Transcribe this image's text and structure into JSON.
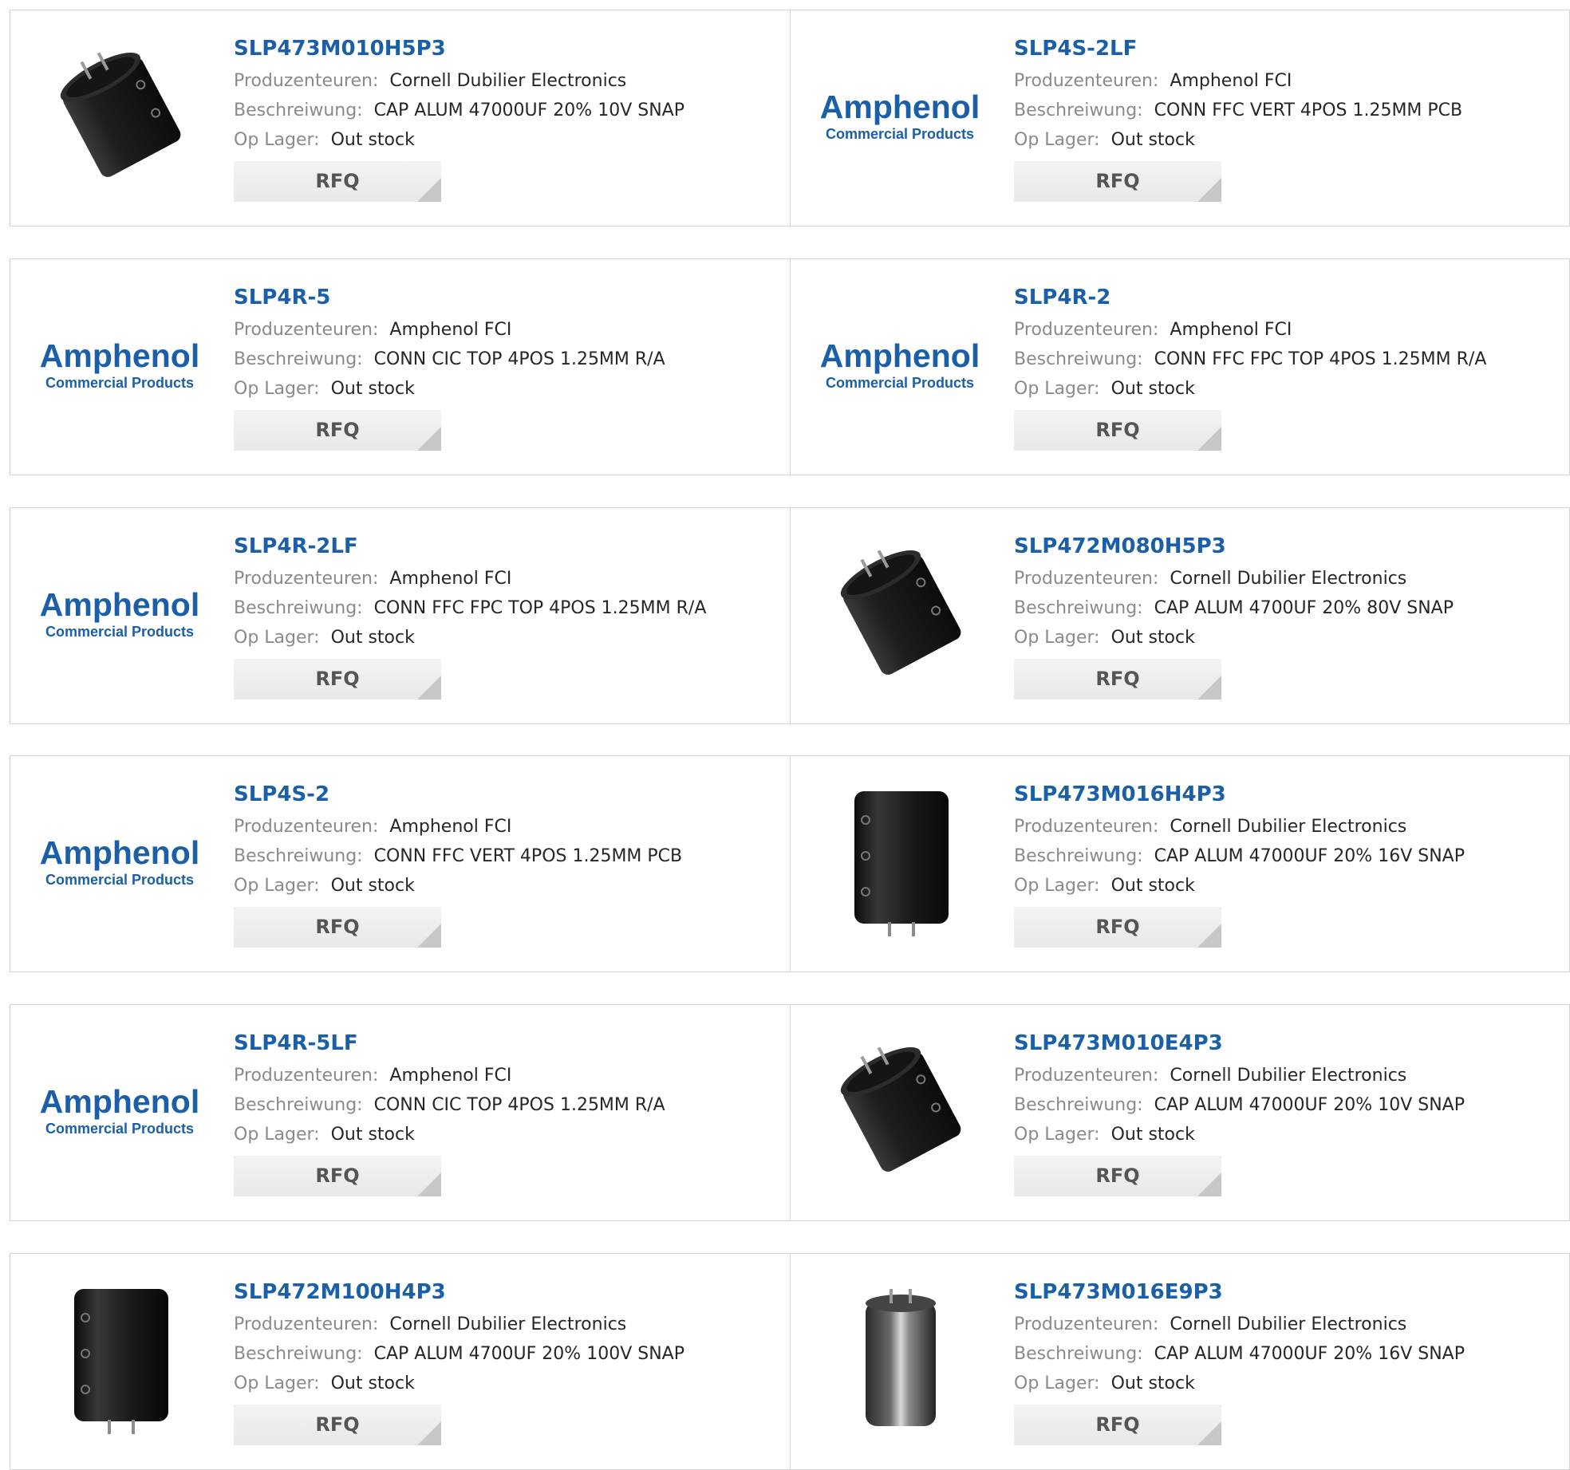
{
  "labels": {
    "manufacturer": "Produzenteuren:",
    "description": "Beschreiwung:",
    "stock": "Op Lager:"
  },
  "rows": [
    [
      {
        "part": "SLP473M010H5P3",
        "manufacturer": "Cornell Dubilier Electronics",
        "description": "CAP ALUM 47000UF 20% 10V SNAP",
        "stock": "Out stock",
        "button": "RFQ",
        "image": "capacitor-tilted"
      },
      {
        "part": "SLP4S-2LF",
        "manufacturer": "Amphenol FCI",
        "description": "CONN FFC VERT 4POS 1.25MM PCB",
        "stock": "Out stock",
        "button": "RFQ",
        "image": "amphenol-logo"
      }
    ],
    [
      {
        "part": "SLP4R-5",
        "manufacturer": "Amphenol FCI",
        "description": "CONN CIC TOP 4POS 1.25MM R/A",
        "stock": "Out stock",
        "button": "RFQ",
        "image": "amphenol-logo"
      },
      {
        "part": "SLP4R-2",
        "manufacturer": "Amphenol FCI",
        "description": "CONN FFC FPC TOP 4POS 1.25MM R/A",
        "stock": "Out stock",
        "button": "RFQ",
        "image": "amphenol-logo"
      }
    ],
    [
      {
        "part": "SLP4R-2LF",
        "manufacturer": "Amphenol FCI",
        "description": "CONN FFC FPC TOP 4POS 1.25MM R/A",
        "stock": "Out stock",
        "button": "RFQ",
        "image": "amphenol-logo"
      },
      {
        "part": "SLP472M080H5P3",
        "manufacturer": "Cornell Dubilier Electronics",
        "description": "CAP ALUM 4700UF 20% 80V SNAP",
        "stock": "Out stock",
        "button": "RFQ",
        "image": "capacitor-tilted"
      }
    ],
    [
      {
        "part": "SLP4S-2",
        "manufacturer": "Amphenol FCI",
        "description": "CONN FFC VERT 4POS 1.25MM PCB",
        "stock": "Out stock",
        "button": "RFQ",
        "image": "amphenol-logo"
      },
      {
        "part": "SLP473M016H4P3",
        "manufacturer": "Cornell Dubilier Electronics",
        "description": "CAP ALUM 47000UF 20% 16V SNAP",
        "stock": "Out stock",
        "button": "RFQ",
        "image": "capacitor-upright"
      }
    ],
    [
      {
        "part": "SLP4R-5LF",
        "manufacturer": "Amphenol FCI",
        "description": "CONN CIC TOP 4POS 1.25MM R/A",
        "stock": "Out stock",
        "button": "RFQ",
        "image": "amphenol-logo"
      },
      {
        "part": "SLP473M010E4P3",
        "manufacturer": "Cornell Dubilier Electronics",
        "description": "CAP ALUM 47000UF 20% 10V SNAP",
        "stock": "Out stock",
        "button": "RFQ",
        "image": "capacitor-tilted"
      }
    ],
    [
      {
        "part": "SLP472M100H4P3",
        "manufacturer": "Cornell Dubilier Electronics",
        "description": "CAP ALUM 4700UF 20% 100V SNAP",
        "stock": "Out stock",
        "button": "RFQ",
        "image": "capacitor-upright"
      },
      {
        "part": "SLP473M016E9P3",
        "manufacturer": "Cornell Dubilier Electronics",
        "description": "CAP ALUM 47000UF 20% 16V SNAP",
        "stock": "Out stock",
        "button": "RFQ",
        "image": "capacitor-silver"
      }
    ]
  ],
  "logo": {
    "brand": "Amphenol",
    "tagline": "Commercial Products"
  },
  "colors": {
    "link": "#1a5fa8",
    "label": "#8a8a8a",
    "value": "#262626",
    "border": "#d4d4d4",
    "button_bg": "#eeeeee",
    "button_text": "#555555",
    "logo_blue": "#1a5fa8"
  }
}
